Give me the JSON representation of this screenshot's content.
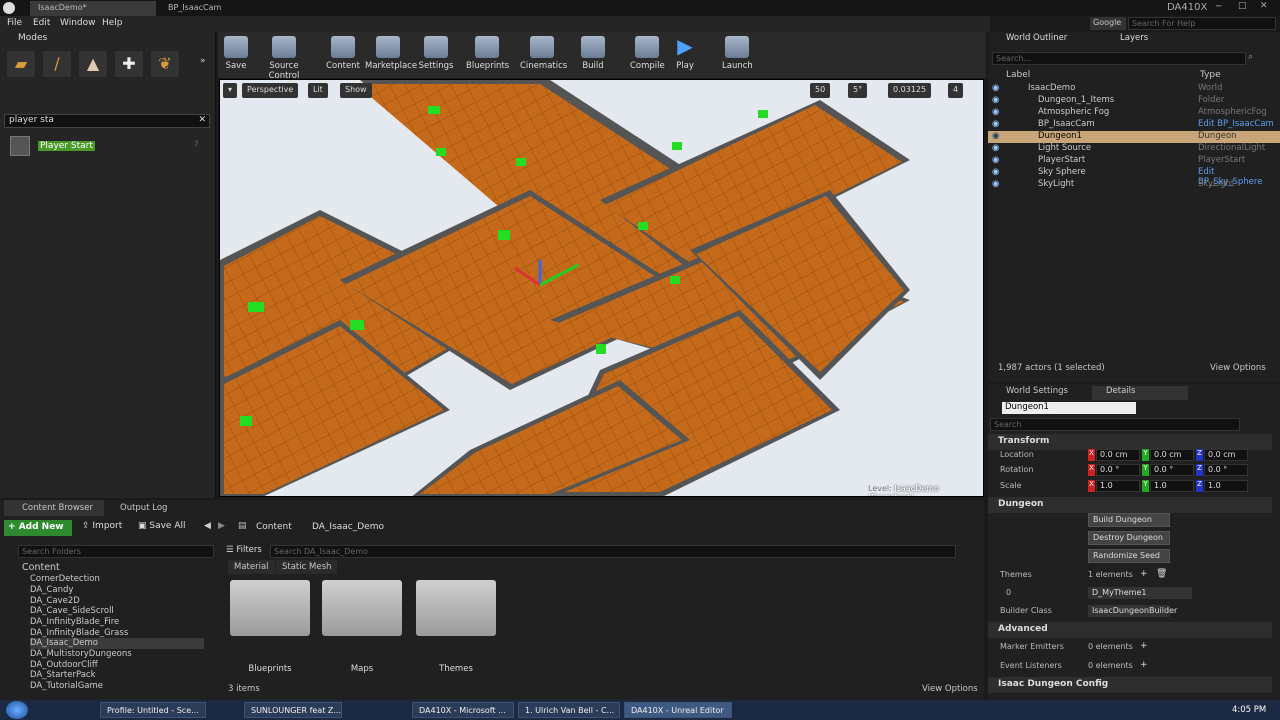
{
  "titlebar": {
    "tabs": [
      "IsaacDemo*",
      "BP_IsaacCam"
    ],
    "app_name": "DA410X",
    "search_scope": "Google",
    "search_placeholder": "Search For Help"
  },
  "menu": [
    "File",
    "Edit",
    "Window",
    "Help"
  ],
  "modes": {
    "title": "Modes",
    "search_value": "player sta",
    "result_label": "Player Start"
  },
  "toolbar": {
    "buttons": [
      "Save",
      "Source Control",
      "Content",
      "Marketplace",
      "Settings",
      "Blueprints",
      "Cinematics",
      "Build",
      "Compile",
      "Play",
      "Launch"
    ]
  },
  "viewport": {
    "perspective_label": "Perspective",
    "lit_label": "Lit",
    "show_label": "Show",
    "snap_grid": "50",
    "snap_rot": "5°",
    "snap_scale": "0.03125",
    "camera_speed": "4",
    "level_prefix": "Level:",
    "level_name": "IsaacDemo (Persistent)"
  },
  "outliner": {
    "tab_world": "World Outliner",
    "tab_layers": "Layers",
    "search_placeholder": "Search...",
    "col_label": "Label",
    "col_type": "Type",
    "rows": [
      {
        "label": "IsaacDemo",
        "type": "World"
      },
      {
        "label": "Dungeon_1_Items",
        "type": "Folder"
      },
      {
        "label": "Atmospheric Fog",
        "type": "AtmosphericFog"
      },
      {
        "label": "BP_IsaacCam",
        "type": "Edit BP_IsaacCam"
      },
      {
        "label": "Dungeon1",
        "type": "Dungeon"
      },
      {
        "label": "Light Source",
        "type": "DirectionalLight"
      },
      {
        "label": "PlayerStart",
        "type": "PlayerStart"
      },
      {
        "label": "Sky Sphere",
        "type": "Edit BP_Sky_Sphere"
      },
      {
        "label": "SkyLight",
        "type": "SkyLight"
      }
    ],
    "status": "1,987 actors (1 selected)",
    "view_options": "View Options"
  },
  "details": {
    "tab_world_settings": "World Settings",
    "tab_details": "Details",
    "object_name": "Dungeon1",
    "search_placeholder": "Search",
    "transform_title": "Transform",
    "location_label": "Location",
    "rotation_label": "Rotation",
    "scale_label": "Scale",
    "location": [
      "0.0 cm",
      "0.0 cm",
      "0.0 cm"
    ],
    "rotation": [
      "0.0 °",
      "0.0 °",
      "0.0 °"
    ],
    "scale": [
      "1.0",
      "1.0",
      "1.0"
    ],
    "dungeon_title": "Dungeon",
    "build_btn": "Build Dungeon",
    "destroy_btn": "Destroy Dungeon",
    "seed_btn": "Randomize Seed",
    "themes_label": "Themes",
    "themes_count": "1 elements",
    "theme_index": "0",
    "theme_value": "D_MyTheme1",
    "builder_label": "Builder Class",
    "builder_value": "IsaacDungeonBuilder",
    "advanced_title": "Advanced",
    "marker_label": "Marker Emitters",
    "marker_count": "0 elements",
    "event_label": "Event Listeners",
    "event_count": "0 elements",
    "config_title": "Isaac Dungeon Config"
  },
  "content_browser": {
    "tab_cb": "Content Browser",
    "tab_log": "Output Log",
    "add_new": "Add New",
    "import": "Import",
    "save_all": "Save All",
    "crumb_root": "Content",
    "crumb_folder": "DA_Isaac_Demo",
    "search_folders_placeholder": "Search Folders",
    "filters_label": "Filters",
    "search_assets_placeholder": "Search DA_Isaac_Demo",
    "filter_chips": [
      "Material",
      "Static Mesh"
    ],
    "tree": [
      "Content",
      "CornerDetection",
      "DA_Candy",
      "DA_Cave2D",
      "DA_Cave_SideScroll",
      "DA_InfinityBlade_Fire",
      "DA_InfinityBlade_Grass",
      "DA_Isaac_Demo",
      "DA_MultistoryDungeons",
      "DA_OutdoorCliff",
      "DA_StarterPack",
      "DA_TutorialGame"
    ],
    "folders": [
      "Blueprints",
      "Maps",
      "Themes"
    ],
    "item_count": "3 items",
    "view_options": "View Options"
  },
  "taskbar": {
    "items": [
      "Profile: Untitled - Sce...",
      "SUNLOUNGER feat Z...",
      "DA410X - Microsoft ...",
      "1. Ulrich Van Bell - C...",
      "DA410X - Unreal Editor"
    ],
    "clock": "4:05 PM"
  }
}
